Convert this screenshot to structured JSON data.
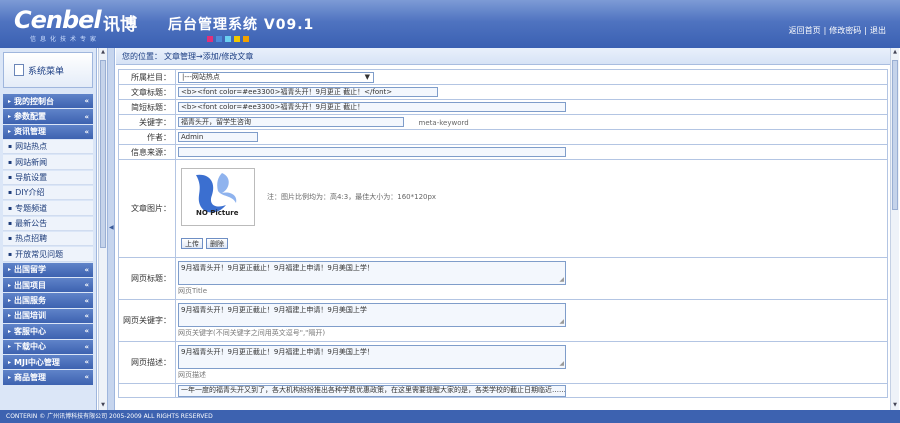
{
  "header": {
    "logo_text": "Cenbel",
    "logo_cn": "讯博",
    "slogan": "信息化技术专家",
    "system_title": "后台管理系统 V09.1",
    "swatch_colors": [
      "#e0307a",
      "#4d8bd9",
      "#6bd0f0",
      "#f0c800",
      "#f0a000"
    ],
    "links": [
      "返回首页",
      "修改密码",
      "退出"
    ]
  },
  "sidebar": {
    "title": "系统菜单",
    "items": [
      {
        "label": "我的控制台",
        "type": "cat"
      },
      {
        "label": "参数配置",
        "type": "cat"
      },
      {
        "label": "资讯管理",
        "type": "cat"
      },
      {
        "label": "网站热点",
        "type": "sub"
      },
      {
        "label": "网站新闻",
        "type": "sub"
      },
      {
        "label": "导航设置",
        "type": "sub"
      },
      {
        "label": "DIY介绍",
        "type": "sub"
      },
      {
        "label": "专题频道",
        "type": "sub"
      },
      {
        "label": "最新公告",
        "type": "sub"
      },
      {
        "label": "热点招聘",
        "type": "sub"
      },
      {
        "label": "开放常见问题",
        "type": "sub"
      },
      {
        "label": "出国留学",
        "type": "cat"
      },
      {
        "label": "出国项目",
        "type": "cat"
      },
      {
        "label": "出国服务",
        "type": "cat"
      },
      {
        "label": "出国培训",
        "type": "cat"
      },
      {
        "label": "客服中心",
        "type": "cat"
      },
      {
        "label": "下载中心",
        "type": "cat"
      },
      {
        "label": "MJI中心管理",
        "type": "cat"
      },
      {
        "label": "商品管理",
        "type": "cat"
      }
    ]
  },
  "main": {
    "breadcrumb_prefix": "您的位置：",
    "breadcrumb": "文章管理→添加/修改文章",
    "form": {
      "channel_label": "所属栏目：",
      "channel_value": "|---网站热点",
      "title_label": "文章标题：",
      "title_value": "<b><font color=#ee3300>福青头开！9月更正 截止！</font>",
      "short_title_label": "简短标题：",
      "short_title_value": "<b><font color=#ee3300>福青头开！9月更正 截止！",
      "keyword_label": "关键字：",
      "keyword_value": "福青头开，留学生咨询",
      "keyword_note": "meta-keyword",
      "author_label": "作者：",
      "author_value": "Admin",
      "source_label": "信息来源：",
      "source_value": "",
      "image_label": "文章图片：",
      "no_picture_text": "NO Picture",
      "image_note": "注：图片比例均为：高4:3，最佳大小为：160*120px",
      "upload_button": "上传",
      "delete_button": "删除",
      "seo_title_label": "网页标题：",
      "seo_title_value": "9月福青头开！9月更正截止！9月福建上申请！9月美国上学！",
      "seo_title_hint": "网页Title",
      "seo_keyword_label": "网页关键字：",
      "seo_keyword_value": "9月福青头开！9月更正截止！9月福建上申请！9月美国上学",
      "seo_keyword_hint": "网页关键字(不同关键字之间用英文逗号\",\"隔开)",
      "seo_desc_label": "网页描述：",
      "seo_desc_value": "9月福青头开！9月更正截止！9月福建上申请！9月美国上学！",
      "seo_desc_hint": "网页描述",
      "content_preview": "一年一度的福青头开又到了，各大机构纷纷推出各种学费优惠政策，在这里需要提醒大家的是，各类学校的截止日期临近……"
    }
  },
  "footer": {
    "copyright": "CONTERIN © 广州讯博科技有限公司 2005-2009 ALL RIGHTS RESERVED"
  }
}
